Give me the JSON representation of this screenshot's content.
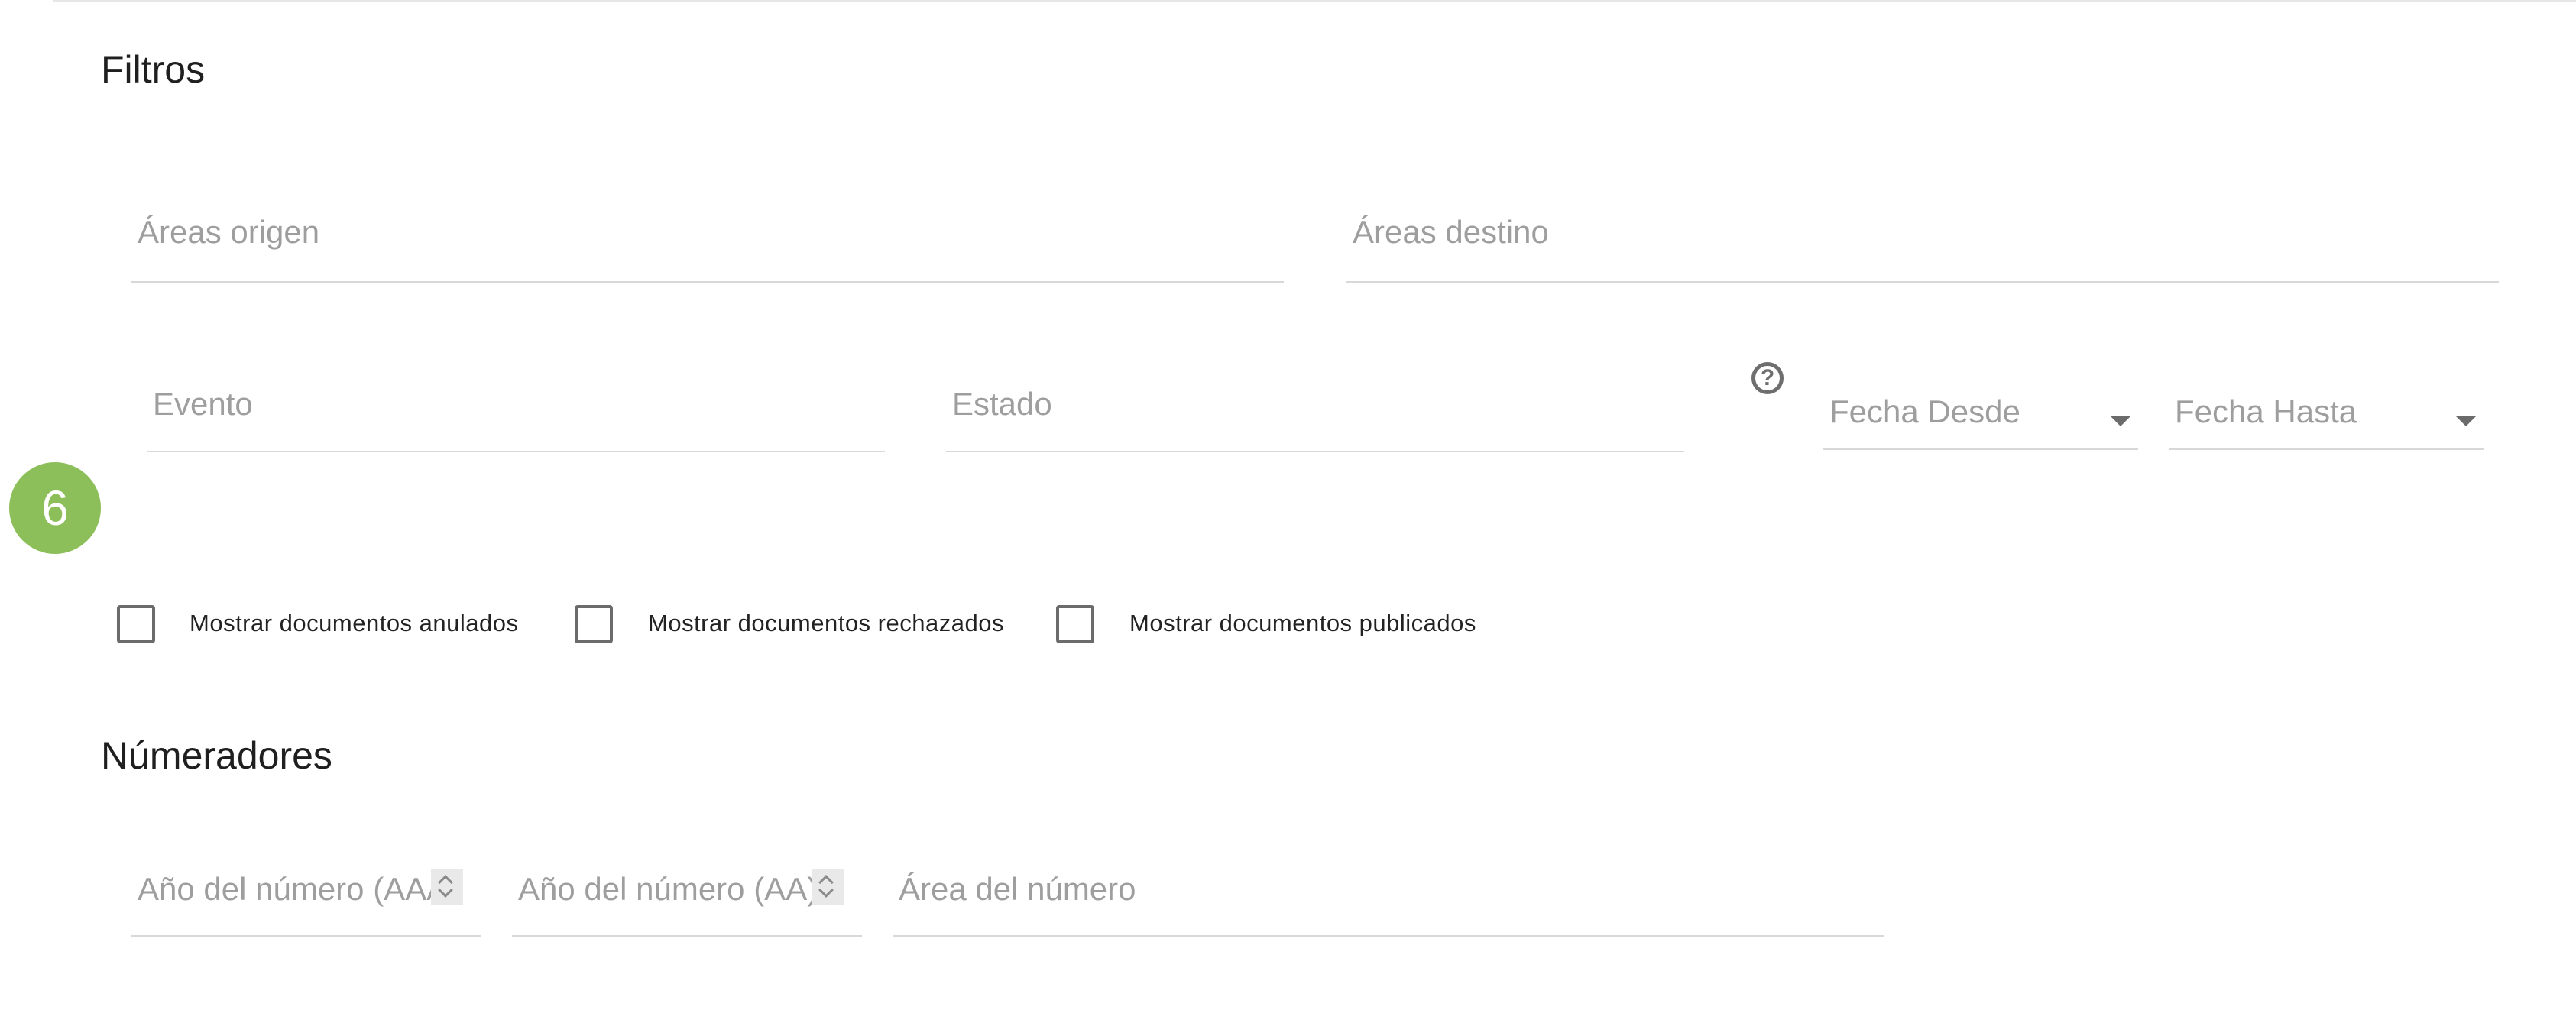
{
  "filters": {
    "title": "Filtros",
    "areas_origen_placeholder": "Áreas origen",
    "areas_destino_placeholder": "Áreas destino",
    "evento_placeholder": "Evento",
    "estado_placeholder": "Estado",
    "fecha_desde_placeholder": "Fecha Desde",
    "fecha_hasta_placeholder": "Fecha Hasta",
    "help_icon": "?"
  },
  "step_badge": "6",
  "checkboxes": [
    {
      "label": "Mostrar documentos anulados",
      "checked": false
    },
    {
      "label": "Mostrar documentos rechazados",
      "checked": false
    },
    {
      "label": "Mostrar documentos publicados",
      "checked": false
    }
  ],
  "numeradores": {
    "title": "Númeradores",
    "anio_aaaa_placeholder": "Año del número (AAA",
    "anio_aa_placeholder": "Año del número (AA)",
    "area_numero_placeholder": "Área del número"
  },
  "colors": {
    "badge": "#8cbe5a",
    "placeholder": "#9e9e9e",
    "underline": "#d8d8d8"
  }
}
